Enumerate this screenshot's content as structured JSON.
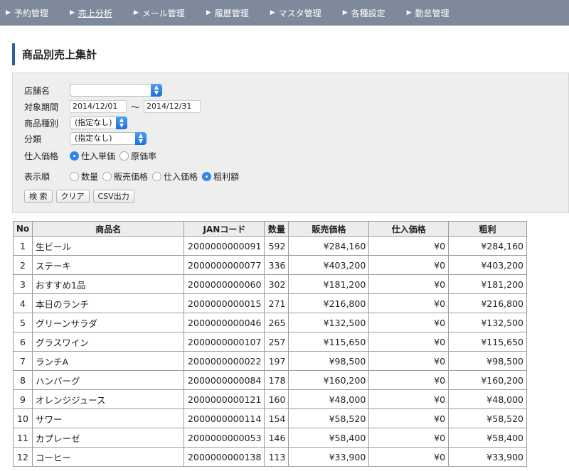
{
  "nav": [
    {
      "label": "予約管理",
      "active": false
    },
    {
      "label": "売上分析",
      "active": true
    },
    {
      "label": "メール管理",
      "active": false
    },
    {
      "label": "履歴管理",
      "active": false
    },
    {
      "label": "マスタ管理",
      "active": false
    },
    {
      "label": "各種設定",
      "active": false
    },
    {
      "label": "勤怠管理",
      "active": false
    }
  ],
  "page": {
    "title": "商品別売上集計"
  },
  "form": {
    "store_label": "店舗名",
    "store_value": "",
    "period_label": "対象期間",
    "period_from": "2014/12/01",
    "period_sep": "〜",
    "period_to": "2014/12/31",
    "product_type_label": "商品種別",
    "product_type_value": "(指定なし)",
    "category_label": "分類",
    "category_value": "(指定なし)",
    "cost_label": "仕入価格",
    "cost_options": [
      {
        "label": "仕入単価",
        "selected": true
      },
      {
        "label": "原価率",
        "selected": false
      }
    ],
    "order_label": "表示順",
    "order_options": [
      {
        "label": "数量",
        "selected": false
      },
      {
        "label": "販売価格",
        "selected": false
      },
      {
        "label": "仕入価格",
        "selected": false
      },
      {
        "label": "粗利額",
        "selected": true
      }
    ],
    "search_button": "検 索",
    "clear_button": "クリア",
    "csv_button": "CSV出力"
  },
  "table": {
    "headers": [
      "No",
      "商品名",
      "JANコード",
      "数量",
      "販売価格",
      "仕入価格",
      "粗利"
    ],
    "rows": [
      [
        "1",
        "生ビール",
        "2000000000091",
        "592",
        "¥284,160",
        "¥0",
        "¥284,160"
      ],
      [
        "2",
        "ステーキ",
        "2000000000077",
        "336",
        "¥403,200",
        "¥0",
        "¥403,200"
      ],
      [
        "3",
        "おすすめ1品",
        "2000000000060",
        "302",
        "¥181,200",
        "¥0",
        "¥181,200"
      ],
      [
        "4",
        "本日のランチ",
        "2000000000015",
        "271",
        "¥216,800",
        "¥0",
        "¥216,800"
      ],
      [
        "5",
        "グリーンサラダ",
        "2000000000046",
        "265",
        "¥132,500",
        "¥0",
        "¥132,500"
      ],
      [
        "6",
        "グラスワイン",
        "2000000000107",
        "257",
        "¥115,650",
        "¥0",
        "¥115,650"
      ],
      [
        "7",
        "ランチA",
        "2000000000022",
        "197",
        "¥98,500",
        "¥0",
        "¥98,500"
      ],
      [
        "8",
        "ハンバーグ",
        "2000000000084",
        "178",
        "¥160,200",
        "¥0",
        "¥160,200"
      ],
      [
        "9",
        "オレンジジュース",
        "2000000000121",
        "160",
        "¥48,000",
        "¥0",
        "¥48,000"
      ],
      [
        "10",
        "サワー",
        "2000000000114",
        "154",
        "¥58,520",
        "¥0",
        "¥58,520"
      ],
      [
        "11",
        "カプレーゼ",
        "2000000000053",
        "146",
        "¥58,400",
        "¥0",
        "¥58,400"
      ],
      [
        "12",
        "コーヒー",
        "2000000000138",
        "113",
        "¥33,900",
        "¥0",
        "¥33,900"
      ]
    ]
  }
}
